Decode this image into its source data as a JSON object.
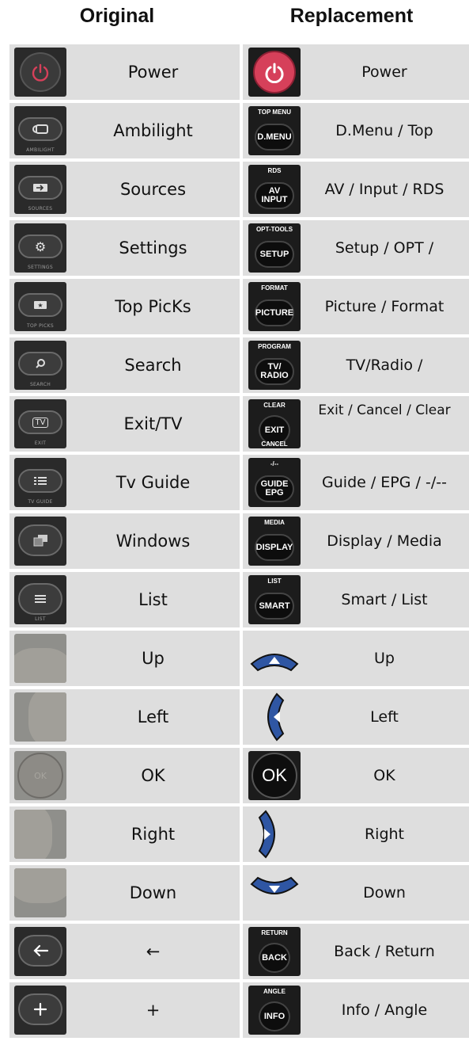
{
  "header": {
    "original": "Original",
    "replacement": "Replacement"
  },
  "rows": [
    {
      "orig_label": "Power",
      "rep_label": "Power",
      "orig_icon": "power-icon",
      "rep_icon": "power-icon"
    },
    {
      "orig_label": "Ambilight",
      "rep_label": "D.Menu / Top",
      "orig_icon": "ambilight-icon",
      "rep_icon": "dmenu-icon",
      "orig_small": "AMBILIGHT",
      "rep_top": "TOP MENU",
      "rep_btn": "D.MENU"
    },
    {
      "orig_label": "Sources",
      "rep_label": "AV / Input / RDS",
      "orig_icon": "sources-icon",
      "rep_icon": "av-input-icon",
      "orig_small": "SOURCES",
      "rep_top": "RDS",
      "rep_btn": "AV INPUT"
    },
    {
      "orig_label": "Settings",
      "rep_label": "Setup / OPT /",
      "orig_icon": "gear-icon",
      "rep_icon": "setup-icon",
      "orig_small": "SETTINGS",
      "rep_top": "OPT-TOOLS",
      "rep_btn": "SETUP"
    },
    {
      "orig_label": "Top PicKs",
      "rep_label": "Picture / Format",
      "orig_icon": "star-icon",
      "rep_icon": "picture-icon",
      "orig_small": "TOP PICKS",
      "rep_top": "FORMAT",
      "rep_btn": "PICTURE"
    },
    {
      "orig_label": "Search",
      "rep_label": "TV/Radio /",
      "orig_icon": "search-icon",
      "rep_icon": "tv-radio-icon",
      "orig_small": "SEARCH",
      "rep_top": "PROGRAM",
      "rep_btn": "TV/ RADIO"
    },
    {
      "orig_label": "Exit/TV",
      "rep_label": "Exit / Cancel / Clear",
      "orig_icon": "tv-icon",
      "rep_icon": "exit-icon",
      "orig_small": "EXIT",
      "orig_pill": "TV",
      "rep_top": "CLEAR",
      "rep_btn": "EXIT",
      "rep_bottom": "CANCEL"
    },
    {
      "orig_label": "Tv Guide",
      "rep_label": "Guide / EPG / -/--",
      "orig_icon": "guide-icon",
      "rep_icon": "guide-epg-icon",
      "orig_small": "TV GUIDE",
      "rep_top": "-/--",
      "rep_btn": "GUIDE EPG"
    },
    {
      "orig_label": "Windows",
      "rep_label": "Display / Media",
      "orig_icon": "windows-icon",
      "rep_icon": "display-icon",
      "rep_top": "MEDIA",
      "rep_btn": "DISPLAY"
    },
    {
      "orig_label": "List",
      "rep_label": "Smart / List",
      "orig_icon": "list-icon",
      "rep_icon": "smart-icon",
      "orig_small": "LIST",
      "rep_top": "LIST",
      "rep_btn": "SMART"
    },
    {
      "orig_label": "Up",
      "rep_label": "Up",
      "orig_icon": "dpad-up-icon",
      "rep_icon": "arrow-up-icon"
    },
    {
      "orig_label": "Left",
      "rep_label": "Left",
      "orig_icon": "dpad-left-icon",
      "rep_icon": "arrow-left-icon"
    },
    {
      "orig_label": "OK",
      "rep_label": "OK",
      "orig_icon": "ok-icon",
      "rep_icon": "ok-icon",
      "orig_ok": "OK",
      "rep_ok": "OK"
    },
    {
      "orig_label": "Right",
      "rep_label": "Right",
      "orig_icon": "dpad-right-icon",
      "rep_icon": "arrow-right-icon"
    },
    {
      "orig_label": "Down",
      "rep_label": "Down",
      "orig_icon": "dpad-down-icon",
      "rep_icon": "arrow-down-icon"
    },
    {
      "orig_label": "←",
      "rep_label": "Back / Return",
      "orig_icon": "back-arrow-icon",
      "rep_icon": "back-icon",
      "rep_top": "RETURN",
      "rep_btn": "BACK"
    },
    {
      "orig_label": "+",
      "rep_label": "Info / Angle",
      "orig_icon": "plus-icon",
      "rep_icon": "info-icon",
      "rep_top": "ANGLE",
      "rep_btn": "INFO"
    }
  ],
  "colors": {
    "cell_bg": "#dedede",
    "power_red": "#d6405a",
    "dpad_blue": "#2f56a3"
  }
}
